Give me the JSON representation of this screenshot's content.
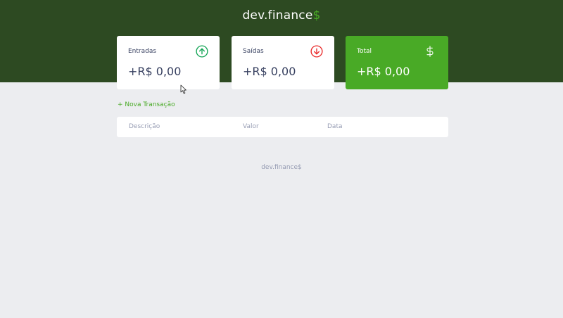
{
  "header": {
    "logo_main": "dev.finance",
    "logo_symbol": "$",
    "background": "#2d4a22",
    "accent": "#49aa26"
  },
  "cards": {
    "income": {
      "label": "Entradas",
      "value": "+R$ 0,00",
      "icon": "arrow-up-circle-icon",
      "icon_color": "#12a454"
    },
    "expense": {
      "label": "Saídas",
      "value": "+R$ 0,00",
      "icon": "arrow-down-circle-icon",
      "icon_color": "#e92929"
    },
    "total": {
      "label": "Total",
      "value": "+R$ 0,00",
      "icon": "dollar-icon",
      "background": "#49aa26"
    }
  },
  "actions": {
    "new_transaction": "+ Nova Transação"
  },
  "table": {
    "columns": [
      "Descrição",
      "Valor",
      "Data"
    ],
    "rows": []
  },
  "footer": {
    "text": "dev.finance$"
  }
}
